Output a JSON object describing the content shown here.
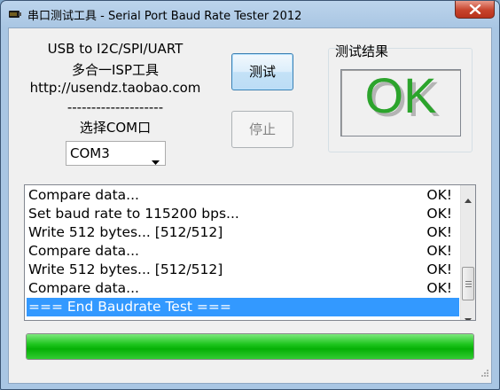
{
  "window": {
    "title": "串口测试工具 - Serial Port Baud Rate Tester 2012",
    "close_icon": "close-icon"
  },
  "info": {
    "line1": "USB to I2C/SPI/UART",
    "line2": "多合一ISP工具",
    "line3": "http://usendz.taobao.com",
    "separator": "--------------------",
    "com_label": "选择COM口"
  },
  "buttons": {
    "test_label": "测试",
    "stop_label": "停止"
  },
  "result": {
    "label": "测试结果",
    "value": "OK",
    "color": "#2ca42c"
  },
  "com_select": {
    "value": "COM3"
  },
  "log": {
    "rows": [
      {
        "msg": "Compare data...",
        "status": "OK!"
      },
      {
        "msg": "Set baud rate to 115200 bps...",
        "status": "OK!"
      },
      {
        "msg": "Write 512 bytes... [512/512]",
        "status": "OK!"
      },
      {
        "msg": "Compare data...",
        "status": "OK!"
      },
      {
        "msg": "Write 512 bytes... [512/512]",
        "status": "OK!"
      },
      {
        "msg": "Compare data...",
        "status": "OK!"
      },
      {
        "msg": "=== End Baudrate Test ===",
        "status": ""
      }
    ],
    "selected_color": "#3399ff"
  },
  "progress": {
    "fraction": 1.0,
    "color": "#0fbf0f"
  }
}
